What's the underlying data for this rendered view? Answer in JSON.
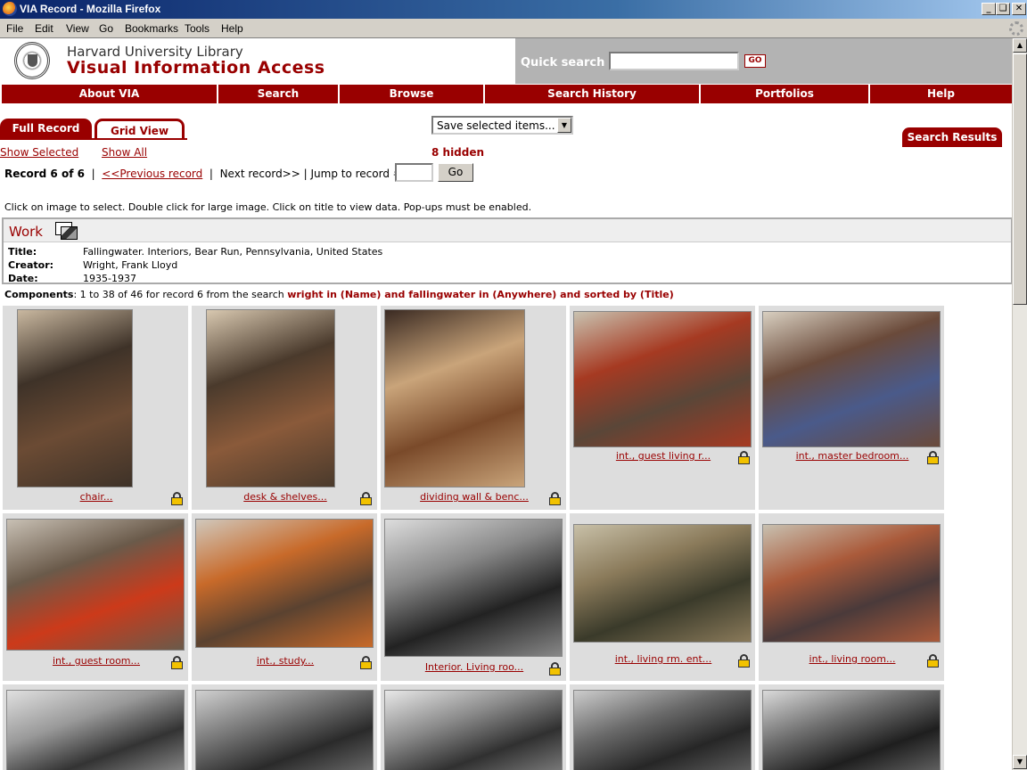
{
  "window": {
    "title": "VIA Record - Mozilla Firefox",
    "buttons": [
      "_",
      "❏",
      "✕"
    ]
  },
  "menubar": [
    "File",
    "Edit",
    "View",
    "Go",
    "Bookmarks",
    "Tools",
    "Help"
  ],
  "header": {
    "library": "Harvard University Library",
    "app": "Visual Information Access",
    "quick_search_label": "Quick search",
    "quick_search_value": "",
    "go_label": "GO"
  },
  "nav": [
    "About VIA",
    "Search",
    "Browse",
    "Search History",
    "Portfolios",
    "Help"
  ],
  "tabs": {
    "full_record": "Full Record",
    "grid_view": "Grid View"
  },
  "save_select": "Save selected items...",
  "search_results": "Search Results",
  "show_selected": "Show Selected",
  "show_all": "Show All",
  "hidden": "8 hidden",
  "record_nav": {
    "current": "Record 6 of 6",
    "sep1": "|",
    "previous": "<<Previous record",
    "sep2": "|",
    "next": "Next record>>",
    "sep3": "|",
    "jump_label": "Jump to record #",
    "jump_value": "",
    "go": "Go"
  },
  "instructions": "Click on image to select. Double click for large image. Click on title to view data. Pop-ups must be enabled.",
  "work": {
    "heading": "Work",
    "fields": [
      {
        "label": "Title:",
        "value": "Fallingwater. Interiors, Bear Run, Pennsylvania, United States"
      },
      {
        "label": "Creator:",
        "value": "Wright, Frank Lloyd"
      },
      {
        "label": "Date:",
        "value": "1935-1937"
      }
    ]
  },
  "components": {
    "label": "Components",
    "text1": ": 1 to 38 of 46 for record 6 from the search ",
    "query": "wright in (Name) and fallingwater in (Anywhere) and sorted by (Title)"
  },
  "grid": [
    {
      "caption": "chair...",
      "palette": [
        "#6b4b34",
        "#3e3228",
        "#c9b8a0"
      ]
    },
    {
      "caption": "desk & shelves...",
      "palette": [
        "#8a5a3a",
        "#4a3a2c",
        "#d8c8b0"
      ]
    },
    {
      "caption": "dividing wall & benc...",
      "palette": [
        "#7a4a2a",
        "#c9a47a",
        "#3a2a22"
      ]
    },
    {
      "caption": "int., guest living r...",
      "palette": [
        "#5a4638",
        "#a63a22",
        "#c9c2b0"
      ]
    },
    {
      "caption": "int., master bedroom...",
      "palette": [
        "#4a5a8a",
        "#6a4a3a",
        "#d8cfc0"
      ]
    },
    {
      "caption": "int., guest room...",
      "palette": [
        "#cc3a1a",
        "#6a5a4a",
        "#c8c0b4"
      ]
    },
    {
      "caption": "int., study...",
      "palette": [
        "#5a4230",
        "#c86a2a",
        "#d0c8bc"
      ]
    },
    {
      "caption": "Interior. Living roo...",
      "palette": [
        "#222222",
        "#888888",
        "#dddddd"
      ]
    },
    {
      "caption": "int., living rm. ent...",
      "palette": [
        "#3a3a2a",
        "#8a7a5a",
        "#c8c0a8"
      ]
    },
    {
      "caption": "int., living room...",
      "palette": [
        "#4a3a3a",
        "#aa5a3a",
        "#c8c0b0"
      ]
    },
    {
      "caption": "",
      "palette": [
        "#333333",
        "#999999",
        "#e0e0e0"
      ]
    },
    {
      "caption": "",
      "palette": [
        "#2a2a2a",
        "#777777",
        "#d0d0d0"
      ]
    },
    {
      "caption": "",
      "palette": [
        "#303030",
        "#8a8a8a",
        "#e8e8e8"
      ]
    },
    {
      "caption": "",
      "palette": [
        "#262626",
        "#6a6a6a",
        "#cccccc"
      ]
    },
    {
      "caption": "",
      "palette": [
        "#1e1e1e",
        "#707070",
        "#dadada"
      ]
    }
  ],
  "colors": {
    "accent": "#990000",
    "header_gray": "#b3b3b3",
    "cell_bg": "#dddddd"
  }
}
